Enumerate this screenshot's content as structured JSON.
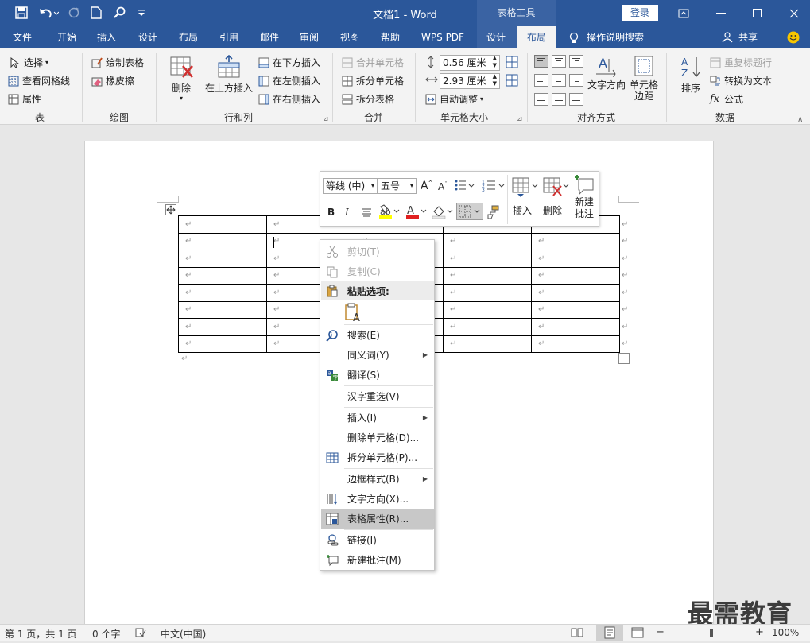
{
  "titlebar": {
    "doc_title": "文档1  -  Word",
    "context_group": "表格工具",
    "login": "登录"
  },
  "tabs": [
    {
      "label": "文件"
    },
    {
      "label": "开始"
    },
    {
      "label": "插入"
    },
    {
      "label": "设计"
    },
    {
      "label": "布局"
    },
    {
      "label": "引用"
    },
    {
      "label": "邮件"
    },
    {
      "label": "审阅"
    },
    {
      "label": "视图"
    },
    {
      "label": "帮助"
    },
    {
      "label": "WPS PDF"
    },
    {
      "label": "设计"
    },
    {
      "label": "布局"
    }
  ],
  "tell_me": "操作说明搜索",
  "share": "共享",
  "ribbon": {
    "table": {
      "select": "选择",
      "view_gridlines": "查看网格线",
      "properties": "属性",
      "group": "表"
    },
    "draw": {
      "draw_table": "绘制表格",
      "eraser": "橡皮擦",
      "group": "绘图"
    },
    "rows_cols": {
      "delete": "删除",
      "insert_above": "在上方插入",
      "insert_below": "在下方插入",
      "insert_left": "在左侧插入",
      "insert_right": "在右侧插入",
      "group": "行和列"
    },
    "merge": {
      "merge_cells": "合并单元格",
      "split_cells": "拆分单元格",
      "split_table": "拆分表格",
      "group": "合并"
    },
    "cell_size": {
      "height": "0.56 厘米",
      "width": "2.93 厘米",
      "autofit": "自动调整",
      "group": "单元格大小"
    },
    "alignment": {
      "text_direction": "文字方向",
      "cell_margins_1": "单元格",
      "cell_margins_2": "边距",
      "group": "对齐方式"
    },
    "data": {
      "sort": "排序",
      "repeat_header": "重复标题行",
      "convert_text": "转换为文本",
      "formula": "公式",
      "group": "数据"
    }
  },
  "mini_toolbar": {
    "font": "等线 (中)",
    "size": "五号",
    "bold": "B",
    "italic": "I",
    "insert": "插入",
    "delete": "删除",
    "new_comment_1": "新建",
    "new_comment_2": "批注"
  },
  "table": {
    "rows": 8,
    "cols": 5,
    "cell_mark": "↵"
  },
  "context_menu": {
    "cut": "剪切(T)",
    "copy": "复制(C)",
    "paste_options": "粘贴选项:",
    "search": "搜索(E)",
    "synonyms": "同义词(Y)",
    "translate": "翻译(S)",
    "reconvert": "汉字重选(V)",
    "insert": "插入(I)",
    "delete_cells": "删除单元格(D)...",
    "split_cells": "拆分单元格(P)...",
    "border_styles": "边框样式(B)",
    "text_direction": "文字方向(X)...",
    "table_properties": "表格属性(R)...",
    "link": "链接(I)",
    "new_comment": "新建批注(M)"
  },
  "statusbar": {
    "page": "第 1 页，共 1 页",
    "words": "0 个字",
    "language": "中文(中国)",
    "zoom": "100%"
  },
  "watermark": "最需教育",
  "colors": {
    "accent": "#2b579a",
    "highlight": "#ffff00",
    "font_color": "#e02020"
  }
}
